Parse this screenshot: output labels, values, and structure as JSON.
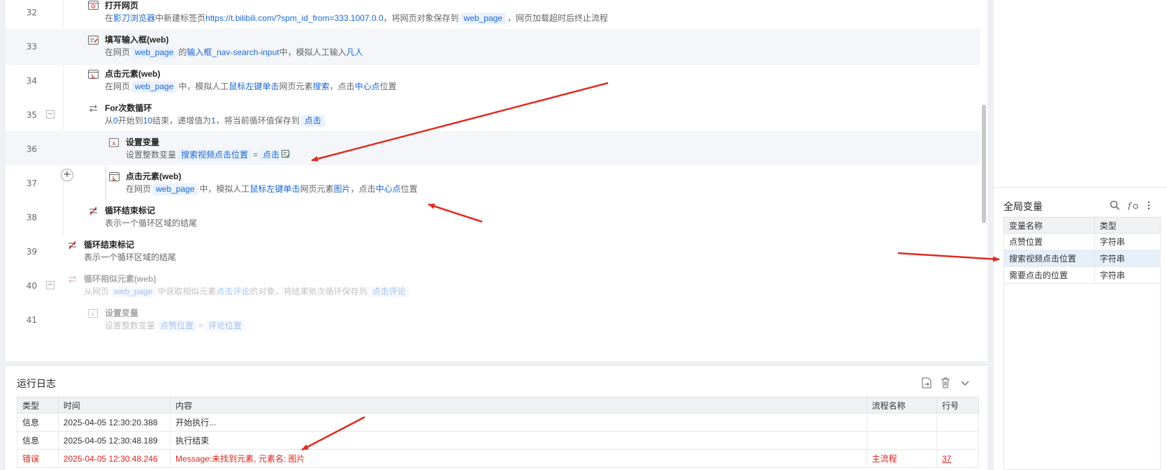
{
  "colors": {
    "accent": "#1a67d2",
    "error": "#d9241f",
    "arrow": "#e02a20"
  },
  "steps": [
    {
      "line": "32",
      "title": "打开网页",
      "icon": "open-webpage-icon",
      "desc": [
        {
          "t": "在"
        },
        {
          "t": "影刀浏览器",
          "k": 1
        },
        {
          "t": "中新建标签页"
        },
        {
          "t": "https://t.bilibili.com/?spm_id_from=333.1007.0.0",
          "k": 1
        },
        {
          "t": "，将网页对象保存到"
        },
        {
          "t": "web_page",
          "v": 1
        },
        {
          "t": "，网页加载超时后终止流程"
        }
      ]
    },
    {
      "line": "33",
      "title": "填写输入框(web)",
      "icon": "fill-input-icon",
      "desc": [
        {
          "t": "在网页"
        },
        {
          "t": "web_page",
          "v": 1
        },
        {
          "t": "的"
        },
        {
          "t": "输入框_nav-search-input",
          "k": 1
        },
        {
          "t": "中，模拟人工输入"
        },
        {
          "t": "凡人",
          "k": 1
        }
      ]
    },
    {
      "line": "34",
      "title": "点击元素(web)",
      "icon": "click-element-icon",
      "desc": [
        {
          "t": "在网页"
        },
        {
          "t": "web_page",
          "v": 1
        },
        {
          "t": "中，模拟人工"
        },
        {
          "t": "鼠标左键单击",
          "k": 1
        },
        {
          "t": "网页元素"
        },
        {
          "t": "搜索",
          "k": 1
        },
        {
          "t": "，点击"
        },
        {
          "t": "中心点",
          "k": 1
        },
        {
          "t": "位置"
        }
      ]
    },
    {
      "line": "35",
      "title": "For次数循环",
      "icon": "loop-icon",
      "desc": [
        {
          "t": "从"
        },
        {
          "t": "0",
          "k": 1
        },
        {
          "t": "开始到"
        },
        {
          "t": "10",
          "k": 1
        },
        {
          "t": "结束，递增值为"
        },
        {
          "t": "1",
          "k": 1
        },
        {
          "t": "，将当前循环值保存到"
        },
        {
          "t": "点击",
          "v": 1
        }
      ]
    },
    {
      "line": "36",
      "title": "设置变量",
      "icon": "set-variable-icon",
      "desc": [
        {
          "t": "设置整数变量"
        },
        {
          "t": "搜索视频点击位置",
          "v": 1
        },
        {
          "t": "="
        },
        {
          "t": "点击",
          "v": 1
        }
      ]
    },
    {
      "line": "37",
      "title": "点击元素(web)",
      "icon": "click-element-icon",
      "desc": [
        {
          "t": "在网页"
        },
        {
          "t": "web_page",
          "v": 1
        },
        {
          "t": "中，模拟人工"
        },
        {
          "t": "鼠标左键单击",
          "k": 1
        },
        {
          "t": "网页元素"
        },
        {
          "t": "图片",
          "k": 1
        },
        {
          "t": "，点击"
        },
        {
          "t": "中心点",
          "k": 1
        },
        {
          "t": "位置"
        }
      ]
    },
    {
      "line": "38",
      "title": "循环结束标记",
      "icon": "loop-end-icon",
      "desc": [
        {
          "t": "表示一个循环区域的结尾"
        }
      ]
    },
    {
      "line": "39",
      "title": "循环结束标记",
      "icon": "loop-end-icon",
      "desc": [
        {
          "t": "表示一个循环区域的结尾"
        }
      ]
    },
    {
      "line": "40",
      "title": "循环相似元素(web)",
      "icon": "loop-similar-icon",
      "desc": [
        {
          "t": "从网页"
        },
        {
          "t": "web_page",
          "v": 1
        },
        {
          "t": "中获取相似元素"
        },
        {
          "t": "点击评论",
          "k": 1
        },
        {
          "t": "的对象，将结果依次循环保存到"
        },
        {
          "t": "点击评论",
          "v": 1
        }
      ]
    },
    {
      "line": "41",
      "title": "设置变量",
      "icon": "set-variable-icon",
      "desc": [
        {
          "t": "设置整数变量"
        },
        {
          "t": "点赞位置",
          "v": 1
        },
        {
          "t": "="
        },
        {
          "t": "评论位置",
          "v": 1
        }
      ]
    }
  ],
  "log": {
    "title": "运行日志",
    "columns": [
      "类型",
      "时间",
      "内容",
      "流程名称",
      "行号"
    ],
    "rows": [
      [
        "信息",
        "2025-04-05 12:30:20.388",
        "开始执行...",
        "",
        ""
      ],
      [
        "信息",
        "2025-04-05 12:30:48.189",
        "执行结束",
        "",
        ""
      ],
      [
        "错误",
        "2025-04-05 12:30:48.246",
        "Message:未找到元素, 元素名: 图片",
        "主流程",
        "37"
      ]
    ]
  },
  "globals": {
    "title": "全局变量",
    "columns": [
      "变量名称",
      "类型"
    ],
    "rows": [
      [
        "点赞位置",
        "字符串"
      ],
      [
        "搜索视频点击位置",
        "字符串"
      ],
      [
        "需要点击的位置",
        "字符串"
      ]
    ]
  }
}
